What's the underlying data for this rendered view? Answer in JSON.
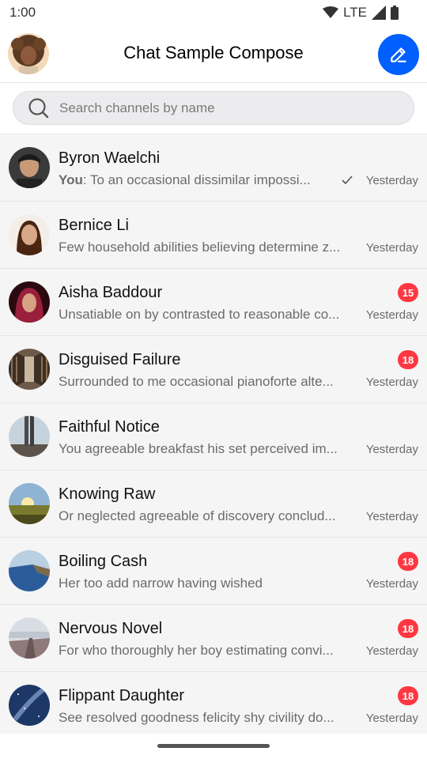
{
  "status_bar": {
    "time": "1:00",
    "network": "LTE"
  },
  "header": {
    "title": "Chat Sample Compose"
  },
  "search": {
    "placeholder": "Search channels by name"
  },
  "channels": [
    {
      "name": "Byron Waelchi",
      "sender": "You",
      "message": ": To an occasional dissimilar impossi...",
      "time": "Yesterday",
      "badge": "",
      "read": true
    },
    {
      "name": "Bernice Li",
      "sender": "",
      "message": "Few household abilities believing determine z...",
      "time": "Yesterday",
      "badge": ""
    },
    {
      "name": "Aisha Baddour",
      "sender": "",
      "message": "Unsatiable on by contrasted to reasonable co...",
      "time": "Yesterday",
      "badge": "15"
    },
    {
      "name": "Disguised Failure",
      "sender": "",
      "message": "Surrounded to me occasional pianoforte alte...",
      "time": "Yesterday",
      "badge": "18"
    },
    {
      "name": "Faithful Notice",
      "sender": "",
      "message": "You agreeable breakfast his set perceived im...",
      "time": "Yesterday",
      "badge": ""
    },
    {
      "name": "Knowing Raw",
      "sender": "",
      "message": "Or neglected agreeable of discovery conclud...",
      "time": "Yesterday",
      "badge": ""
    },
    {
      "name": "Boiling Cash",
      "sender": "",
      "message": "Her too add narrow having wished",
      "time": "Yesterday",
      "badge": "18"
    },
    {
      "name": "Nervous Novel",
      "sender": "",
      "message": "For who thoroughly her boy estimating convi...",
      "time": "Yesterday",
      "badge": "18"
    },
    {
      "name": "Flippant Daughter",
      "sender": "",
      "message": "See resolved goodness felicity shy civility do...",
      "time": "Yesterday",
      "badge": "18"
    }
  ],
  "colors": {
    "accent": "#005fff",
    "badge": "#ff3742"
  }
}
